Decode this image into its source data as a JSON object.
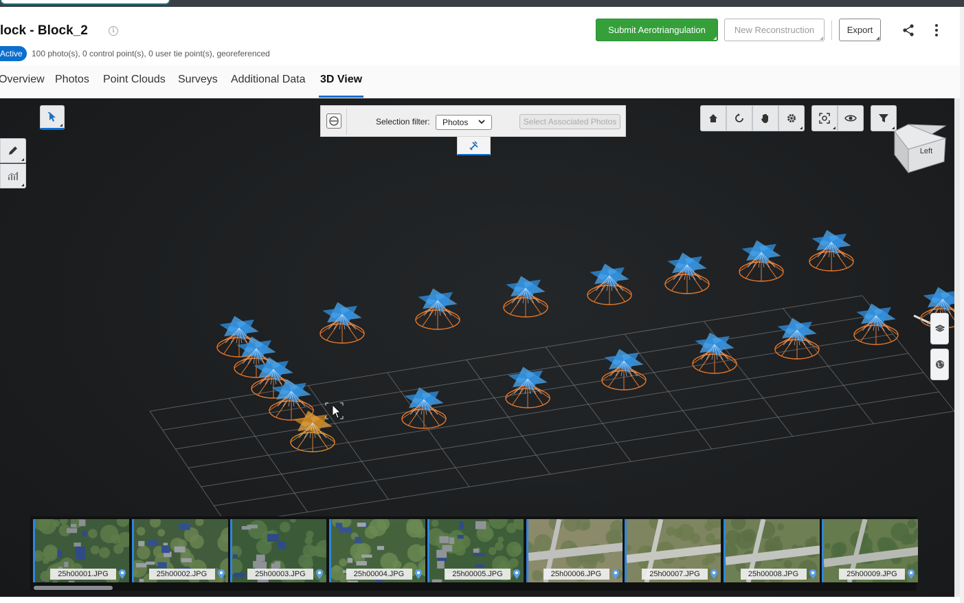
{
  "header": {
    "title": "lock -  Block_2",
    "status_badge": "Active",
    "meta": "100 photo(s), 0 control point(s), 0 user tie point(s), georeferenced",
    "submit_label": "Submit Aerotriangulation",
    "new_reconstruction_label": "New Reconstruction",
    "export_label": "Export"
  },
  "tabs": [
    {
      "label": "Overview"
    },
    {
      "label": "Photos"
    },
    {
      "label": "Point Clouds"
    },
    {
      "label": "Surveys"
    },
    {
      "label": "Additional Data"
    },
    {
      "label": "3D View",
      "active": true
    }
  ],
  "viewer": {
    "selection_filter_label": "Selection filter:",
    "selection_filter_value": "Photos",
    "select_associated_label": "Select Associated Photos",
    "view_cube_face": "Left",
    "left_tools": [
      "select-pointer-icon",
      "measure-pencil-icon",
      "chart-icon"
    ],
    "toolbar_icons": [
      "home-icon",
      "orbit-icon",
      "pan-hand-icon",
      "settings-icon",
      "zoom-fit-icon",
      "visibility-eye-icon",
      "filter-icon"
    ],
    "side_icons": [
      "layers-icon",
      "globe-icon"
    ]
  },
  "filmstrip": {
    "thumbnails": [
      {
        "label": "25h00001.JPG"
      },
      {
        "label": "25h00002.JPG"
      },
      {
        "label": "25h00003.JPG"
      },
      {
        "label": "25h00004.JPG"
      },
      {
        "label": "25h00005.JPG"
      },
      {
        "label": "25h00006.JPG"
      },
      {
        "label": "25h00007.JPG"
      },
      {
        "label": "25h00008.JPG"
      },
      {
        "label": "25h00009.JPG"
      }
    ]
  },
  "colors": {
    "accent": "#0b6fce",
    "primary_button": "#35a03a",
    "camera_blue": "#2f8fe0",
    "camera_orange": "#e8782a",
    "selected_camera": "#c8841f"
  }
}
